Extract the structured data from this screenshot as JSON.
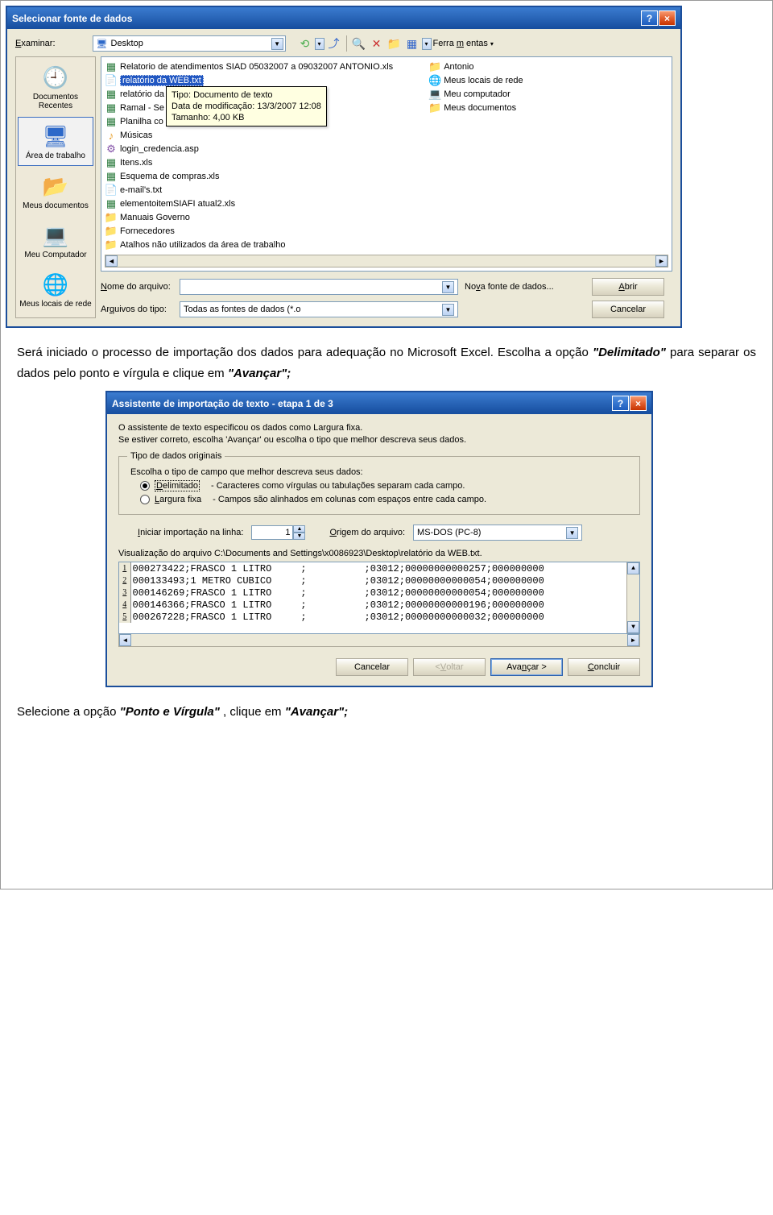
{
  "dialog1": {
    "title": "Selecionar fonte de dados",
    "examinar_label": "Examinar:",
    "examinar_value": "Desktop",
    "ferramentas_label": "Ferramentas",
    "places": [
      {
        "label": "Documentos Recentes"
      },
      {
        "label": "Área de trabalho"
      },
      {
        "label": "Meus documentos"
      },
      {
        "label": "Meu Computador"
      },
      {
        "label": "Meus locais de rede"
      }
    ],
    "files_col1": [
      {
        "icon": "excel",
        "name": "Relatorio de atendimentos SIAD 05032007 a 09032007 ANTONIO.xls"
      },
      {
        "icon": "text",
        "name": "relatório da WEB.txt",
        "selected": true
      },
      {
        "icon": "excel",
        "name": "relatório da WEB.csv"
      },
      {
        "icon": "excel",
        "name": "Ramal - Se"
      },
      {
        "icon": "excel",
        "name": "Planilha co"
      },
      {
        "icon": "music",
        "name": "Músicas"
      },
      {
        "icon": "asp",
        "name": "login_credencia.asp"
      },
      {
        "icon": "excel",
        "name": "Itens.xls"
      },
      {
        "icon": "excel",
        "name": "Esquema de compras.xls"
      },
      {
        "icon": "text",
        "name": "e-mail's.txt"
      },
      {
        "icon": "excel",
        "name": "elementoitemSIAFI atual2.xls"
      },
      {
        "icon": "folder",
        "name": "Manuais Governo"
      },
      {
        "icon": "folder",
        "name": "Fornecedores"
      },
      {
        "icon": "folder",
        "name": "Atalhos não utilizados da área de trabalho"
      }
    ],
    "files_col2": [
      {
        "icon": "folder",
        "name": "Antonio"
      },
      {
        "icon": "netplace",
        "name": "Meus locais de rede"
      },
      {
        "icon": "computer",
        "name": "Meu computador"
      },
      {
        "icon": "folder",
        "name": "Meus documentos"
      }
    ],
    "tooltip": {
      "l1": "Tipo: Documento de texto",
      "l2": "Data de modificação: 13/3/2007 12:08",
      "l3": "Tamanho: 4,00 KB"
    },
    "nome_label": "Nome do arquivo:",
    "nome_value": "",
    "tipo_label": "Arquivos do tipo:",
    "tipo_value": "Todas as fontes de dados (*.o",
    "nova_fonte_label": "Nova fonte de dados...",
    "abrir_label": "Abrir",
    "cancelar_label": "Cancelar"
  },
  "paragraph1": {
    "pre": "Será iniciado o processo de importação dos dados para adequação no Microsoft Excel. Escolha a opção ",
    "bi1": "\"Delimitado\"",
    "mid": " para separar os dados pelo ponto e vírgula e clique em ",
    "bi2": "\"Avançar\";"
  },
  "dialog2": {
    "title": "Assistente de importação de texto - etapa 1 de 3",
    "intro1": "O assistente de texto especificou os dados como Largura fixa.",
    "intro2": "Se estiver correto, escolha 'Avançar' ou escolha o tipo que melhor descreva seus dados.",
    "groupbox": "Tipo de dados originais",
    "group_prompt": "Escolha o tipo de campo que melhor descreva seus dados:",
    "radio_delimitado": "Delimitado",
    "radio_delimitado_desc": "- Caracteres como vírgulas ou tabulações separam cada campo.",
    "radio_largura": "Largura fixa",
    "radio_largura_desc": "- Campos são alinhados em colunas com espaços entre cada campo.",
    "iniciar_label": "Iniciar importação na linha:",
    "iniciar_value": "1",
    "origem_label": "Origem do arquivo:",
    "origem_value": "MS-DOS (PC-8)",
    "preview_label": "Visualização do arquivo C:\\Documents and Settings\\x0086923\\Desktop\\relatório da WEB.txt.",
    "preview_rows": [
      "000273422;FRASCO 1 LITRO     ;          ;03012;00000000000257;000000000",
      "000133493;1 METRO CUBICO     ;          ;03012;00000000000054;000000000",
      "000146269;FRASCO 1 LITRO     ;          ;03012;00000000000054;000000000",
      "000146366;FRASCO 1 LITRO     ;          ;03012;00000000000196;000000000",
      "000267228;FRASCO 1 LITRO     ;          ;03012;00000000000032;000000000"
    ],
    "btn_cancelar": "Cancelar",
    "btn_voltar": "< Voltar",
    "btn_avancar": "Avançar >",
    "btn_concluir": "Concluir"
  },
  "paragraph2": {
    "pre": "Selecione a opção ",
    "bi1": "\"Ponto e Vírgula\"",
    "mid": ", clique em ",
    "bi2": "\"Avançar\";"
  }
}
